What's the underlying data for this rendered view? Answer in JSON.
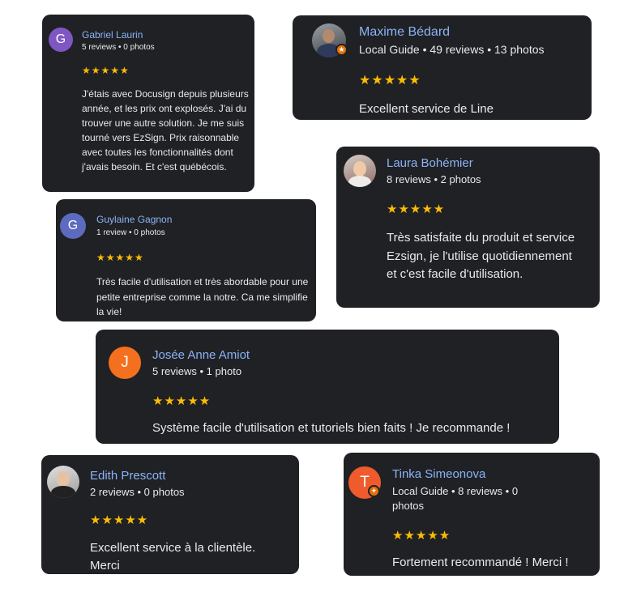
{
  "reviews": [
    {
      "name": "Gabriel Laurin",
      "meta": "5 reviews • 0 photos",
      "initial": "G",
      "avatar_color": "#7e57c2",
      "stars": "★★★★★",
      "text": "J'étais avec Docusign depuis plusieurs année, et les prix ont explosés. J'ai du trouver une autre solution. Je me suis tourné vers EzSign. Prix raisonnable avec toutes les fonctionnalités dont j'avais besoin. Et c'est québécois."
    },
    {
      "name": "Maxime Bédard",
      "meta": "Local Guide • 49 reviews • 13 photos",
      "initial": "",
      "avatar_color": "#5f6368",
      "stars": "★★★★★",
      "text": "Excellent service de Line"
    },
    {
      "name": "Laura Bohémier",
      "meta": "8 reviews • 2 photos",
      "initial": "",
      "avatar_color": "#c9a27e",
      "stars": "★★★★★",
      "text": "Très satisfaite du produit et service Ezsign, je l'utilise quotidiennement et c'est facile d'utilisation."
    },
    {
      "name": "Guylaine Gagnon",
      "meta": "1 review • 0 photos",
      "initial": "G",
      "avatar_color": "#5c6bc0",
      "stars": "★★★★★",
      "text": "Très facile d'utilisation et très abordable pour une petite entreprise comme la notre. Ca me simplifie la vie!"
    },
    {
      "name": "Josée Anne Amiot",
      "meta": "5 reviews • 1 photo",
      "initial": "J",
      "avatar_color": "#f4701f",
      "stars": "★★★★★",
      "text": "Système facile d'utilisation et tutoriels bien faits ! Je recommande !"
    },
    {
      "name": "Edith Prescott",
      "meta": "2 reviews • 0 photos",
      "initial": "",
      "avatar_color": "#9e9e9e",
      "stars": "★★★★★",
      "text": "Excellent service à la clientèle. Merci"
    },
    {
      "name": "Tinka Simeonova",
      "meta": "Local Guide • 8 reviews • 0 photos",
      "initial": "T",
      "avatar_color": "#ef5b2c",
      "stars": "★★★★★",
      "text": "Fortement recommandé ! Merci !"
    }
  ]
}
